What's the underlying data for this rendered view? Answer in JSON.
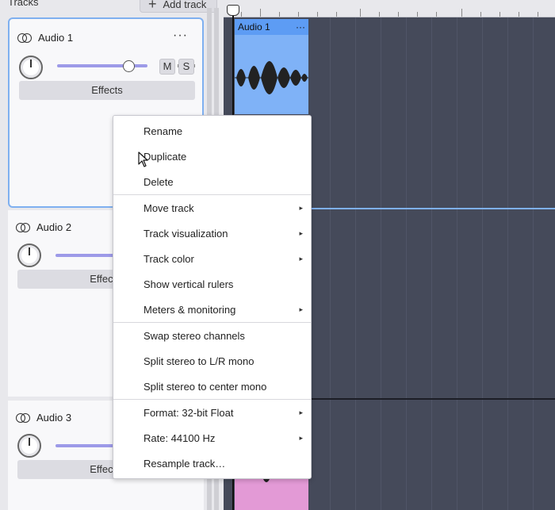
{
  "header": {
    "title": "Tracks",
    "add_track_label": "Add track"
  },
  "tracks": [
    {
      "name": "Audio 1",
      "mute": "M",
      "solo": "S",
      "effects": "Effects"
    },
    {
      "name": "Audio 2",
      "effects": "Effects"
    },
    {
      "name": "Audio 3",
      "effects": "Effects"
    }
  ],
  "clips": [
    {
      "name": "Audio 1",
      "more": "···"
    }
  ],
  "menu": {
    "items": [
      {
        "label": "Rename"
      },
      {
        "label": "Duplicate"
      },
      {
        "label": "Delete"
      },
      {
        "label": "Move track",
        "submenu": true
      },
      {
        "label": "Track visualization",
        "submenu": true
      },
      {
        "label": "Track color",
        "submenu": true
      },
      {
        "label": "Show vertical rulers"
      },
      {
        "label": "Meters & monitoring",
        "submenu": true
      },
      {
        "label": "Swap stereo channels"
      },
      {
        "label": "Split stereo to L/R mono"
      },
      {
        "label": "Split stereo to center mono"
      },
      {
        "label": "Format: 32-bit Float",
        "submenu": true
      },
      {
        "label": "Rate: 44100 Hz",
        "submenu": true
      },
      {
        "label": "Resample track…"
      }
    ]
  },
  "icons": {
    "track_more": "···",
    "submenu_arrow": "▸"
  },
  "colors": {
    "accent": "#7fb0f0",
    "clip_blue": "#7fb2f7",
    "clip_pink": "#e39ad6",
    "timeline_bg": "#454a5a"
  }
}
